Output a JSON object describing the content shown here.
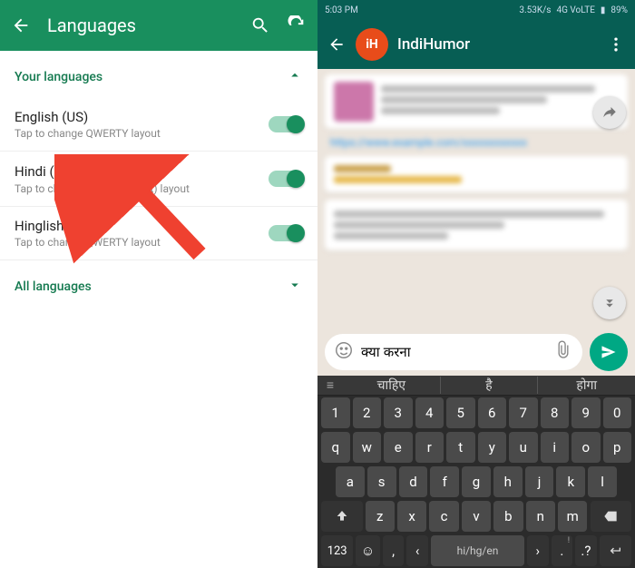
{
  "left": {
    "title": "Languages",
    "section_your": "Your languages",
    "section_all": "All languages",
    "items": [
      {
        "name": "English (US)",
        "sub": "Tap to change QWERTY layout"
      },
      {
        "name": "Hindi (+Phonetic) / हिन्दी",
        "sub": "Tap to change Hindi (Inscript) layout"
      },
      {
        "name": "Hinglish",
        "sub": "Tap to change QWERTY layout"
      }
    ]
  },
  "right": {
    "status": {
      "time": "5:03 PM",
      "net": "3.53K/s",
      "signal": "4G VoLTE",
      "batt": "89%"
    },
    "chat_title": "IndiHumor",
    "input_value": "क्या करना",
    "keyboard": {
      "suggestions": [
        "चाहिए",
        "है",
        "होगा"
      ],
      "num_row": [
        "1",
        "2",
        "3",
        "4",
        "5",
        "6",
        "7",
        "8",
        "9",
        "0"
      ],
      "row1": [
        "q",
        "w",
        "e",
        "r",
        "t",
        "y",
        "u",
        "i",
        "o",
        "p"
      ],
      "row2": [
        "a",
        "s",
        "d",
        "f",
        "g",
        "h",
        "j",
        "k",
        "l"
      ],
      "row3": [
        "z",
        "x",
        "c",
        "v",
        "b",
        "n",
        "m"
      ],
      "mode_key": "123",
      "space_label": "hi/hg/en",
      "comma": ",",
      "period": ".",
      "qmark": "?",
      "excl": "!"
    }
  }
}
